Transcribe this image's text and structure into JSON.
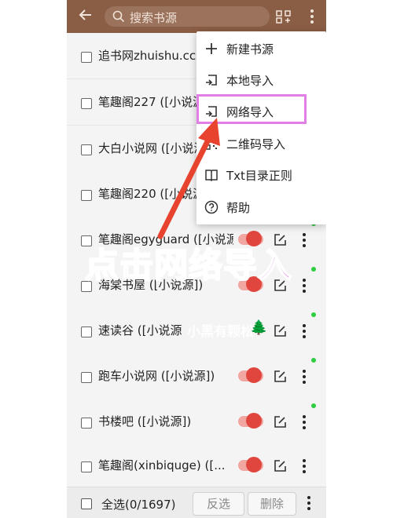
{
  "header": {
    "search_placeholder": "搜索书源"
  },
  "rows": [
    {
      "label": "追书网zhuishu.cc ("
    },
    {
      "label": "笔趣阁227 ([小说源"
    },
    {
      "label": "大白小说网 ([小说源"
    },
    {
      "label": "笔趣阁220 ([小说源"
    },
    {
      "label": "笔趣阁egyguard ([小说源"
    },
    {
      "label": "海棠书屋 ([小说源])"
    },
    {
      "label": "速读谷 ([小说源"
    },
    {
      "label": "跑车小说网 ([小说源])"
    },
    {
      "label": "书楼吧 ([小说源])"
    },
    {
      "label": "笔趣阁(xinbiquge) ([..."
    }
  ],
  "menu": {
    "items": [
      {
        "label": "新建书源",
        "icon": "plus-icon"
      },
      {
        "label": "本地导入",
        "icon": "import-icon"
      },
      {
        "label": "网络导入",
        "icon": "import-icon"
      },
      {
        "label": "二维码导入",
        "icon": "qrcode-icon"
      },
      {
        "label": "Txt目录正则",
        "icon": "book-icon"
      },
      {
        "label": "帮助",
        "icon": "help-icon"
      }
    ]
  },
  "bottom": {
    "select_all": "全选(0/1697)",
    "invert": "反选",
    "delete": "删除"
  },
  "annotation": {
    "callout": "点击网络导入",
    "watermark": "小黑有颗松"
  },
  "colors": {
    "header": "#8a5e45",
    "switch_on": "#e0463d",
    "highlight": "#e27fe6",
    "callout": "#dd73e3",
    "arrow": "#e8432e",
    "status_dot": "#2ecc40"
  }
}
